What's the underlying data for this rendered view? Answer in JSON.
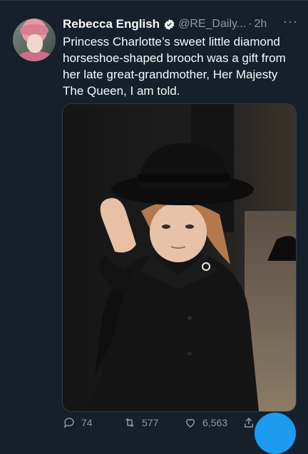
{
  "tweet": {
    "author_name": "Rebecca English",
    "handle": "@RE_Daily...",
    "separator": "·",
    "time": "2h",
    "more_label": "···",
    "text": "Princess Charlotte’s sweet little diamond horseshoe-shaped brooch was a gift from her late great-grandmother, Her Majesty The Queen, I am told.",
    "icons": {
      "verified": "verified-badge-icon",
      "reply": "reply-icon",
      "retweet": "retweet-icon",
      "like": "heart-icon",
      "share": "share-icon"
    }
  },
  "actions": {
    "replies": "74",
    "retweets": "577",
    "likes": "6,563"
  },
  "colors": {
    "background": "#15202b",
    "text": "#f7f9f9",
    "muted": "#8b98a5",
    "accent": "#1d9bf0"
  }
}
